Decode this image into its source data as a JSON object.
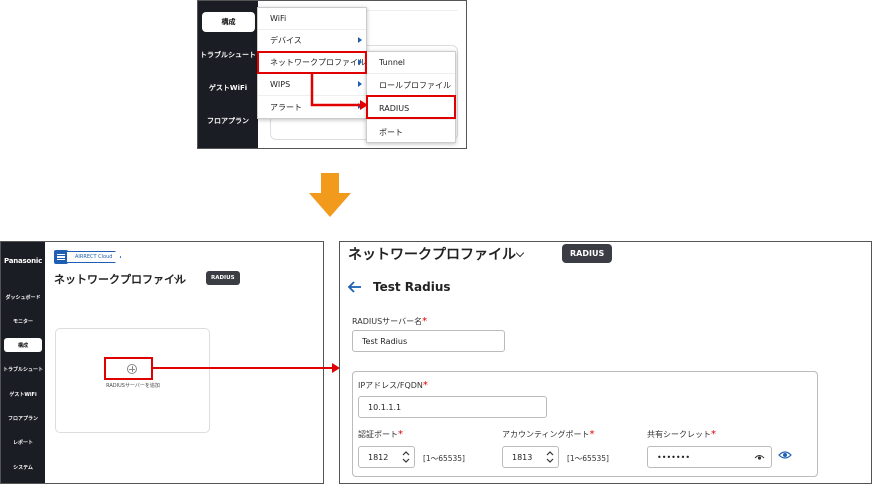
{
  "top": {
    "sidebar": {
      "active": "構成",
      "items": [
        "トラブルシュート",
        "ゲストWiFi",
        "フロアプラン"
      ]
    },
    "menu1": [
      {
        "label": "WiFi",
        "has_sub": false
      },
      {
        "label": "デバイス",
        "has_sub": true
      },
      {
        "label": "ネットワークプロファイル",
        "has_sub": true
      },
      {
        "label": "WIPS",
        "has_sub": true
      },
      {
        "label": "アラート",
        "has_sub": true
      }
    ],
    "menu2": [
      "Tunnel",
      "ロールプロファイル",
      "RADIUS",
      "ポート"
    ]
  },
  "bottom_left": {
    "logo": "Panasonic",
    "nav": [
      "ダッシュボード",
      "モニター",
      "構成",
      "トラブルシュート",
      "ゲストWiFi",
      "フロアプラン",
      "レポート",
      "システム"
    ],
    "active_nav": "構成",
    "cloud_tag": "AIRRECT Cloud",
    "title": "ネットワークプロファイル",
    "badge": "RADIUS",
    "add_label": "RADIUSサーバーを追加"
  },
  "bottom_right": {
    "title": "ネットワークプロファイル",
    "badge": "RADIUS",
    "heading": "Test Radius",
    "server_name": {
      "label": "RADIUSサーバー名",
      "value": "Test Radius"
    },
    "ip": {
      "label": "IPアドレス/FQDN",
      "value": "10.1.1.1"
    },
    "auth_port": {
      "label": "認証ポート",
      "value": "1812",
      "range": "[1〜65535]"
    },
    "acct_port": {
      "label": "アカウンティングポート",
      "value": "1813",
      "range": "[1〜65535]"
    },
    "secret": {
      "label": "共有シークレット",
      "value": "•••••••"
    },
    "required_mark": "*"
  },
  "colors": {
    "sidebar": "#1b1d24",
    "accent": "#1f5fb3",
    "highlight": "#e00000",
    "arrow": "#f29a1c"
  }
}
